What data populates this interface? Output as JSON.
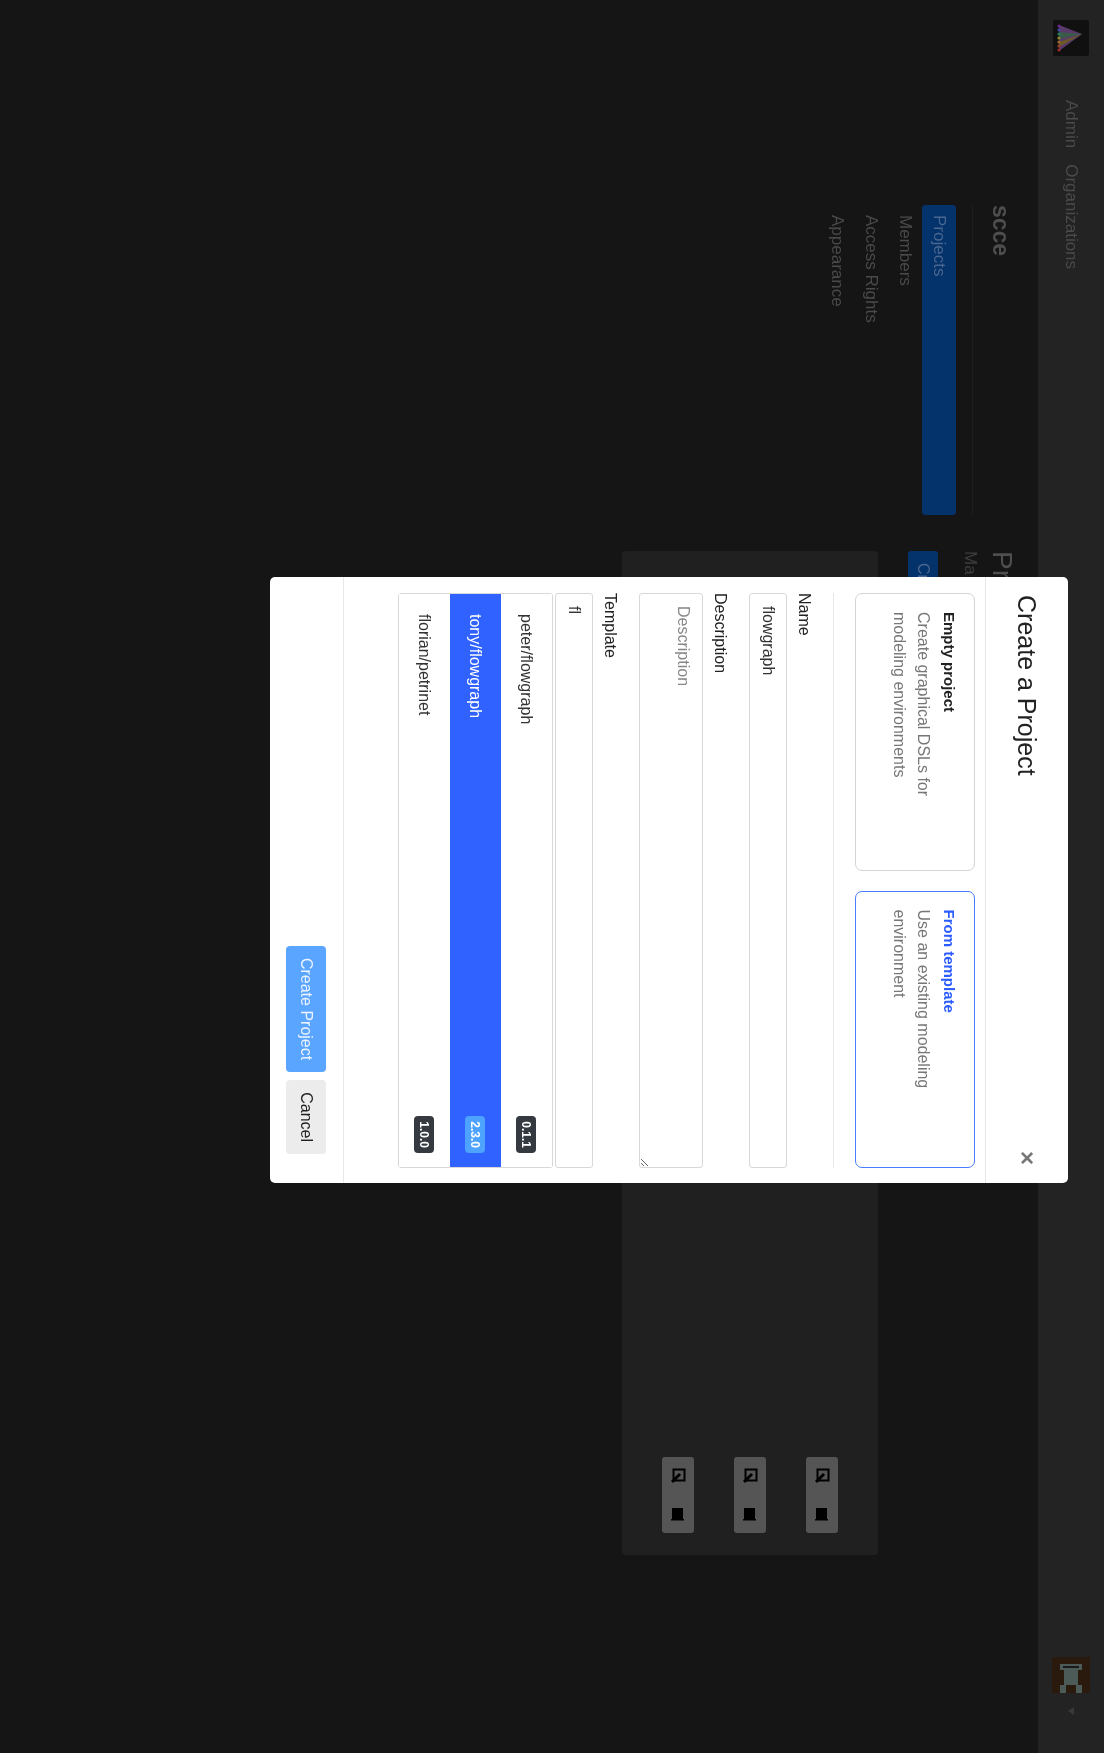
{
  "navbar": {
    "links": [
      {
        "label": "Admin"
      },
      {
        "label": "Organizations"
      }
    ]
  },
  "sidebar": {
    "title": "scce",
    "items": [
      {
        "label": "Projects",
        "selected": true
      },
      {
        "label": "Members",
        "selected": false
      },
      {
        "label": "Access Rights",
        "selected": false
      },
      {
        "label": "Appearance",
        "selected": false
      }
    ]
  },
  "main": {
    "heading": "Pr",
    "subtitle": "Ma",
    "create_button": "Cr",
    "rows": [
      {
        "kind": "project"
      },
      {
        "kind": "project"
      },
      {
        "kind": "project"
      }
    ]
  },
  "modal": {
    "title": "Create a Project",
    "close": "×",
    "options": [
      {
        "title": "Empty project",
        "description": "Create graphical DSLs for modeling environments",
        "selected": false
      },
      {
        "title": "From template",
        "description": "Use an existing modeling environment",
        "selected": true
      }
    ],
    "name": {
      "label": "Name",
      "value": "flowgraph"
    },
    "description": {
      "label": "Description",
      "placeholder": "Description"
    },
    "template": {
      "label": "Template",
      "value": "fl"
    },
    "templates": [
      {
        "name": "peter/flowgraph",
        "version": "0.1.1",
        "selected": false
      },
      {
        "name": "tony/flowgraph",
        "version": "2.3.0",
        "selected": true
      },
      {
        "name": "florian/petrinet",
        "version": "1.0.0",
        "selected": false
      }
    ],
    "buttons": [
      {
        "label": "Create Project",
        "kind": "primary"
      },
      {
        "label": "Cancel",
        "kind": "secondary"
      }
    ]
  }
}
